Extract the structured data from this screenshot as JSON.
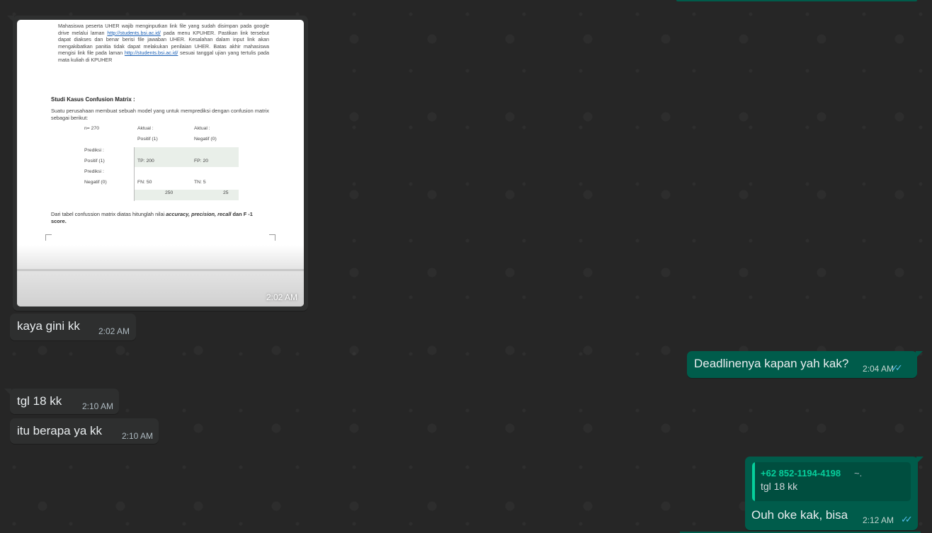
{
  "messages": {
    "image_msg": {
      "time": "2:02 AM",
      "doc": {
        "para_1": "Mahasiswa peserta UHER wajib menginputkan link file yang sudah disimpan pada google drive melalui laman",
        "link_1": "http://students.bsi.ac.id/",
        "para_2": " pada menu KPUHER. Pastikan link tersebut dapat diakses dan benar berisi file jawaban UHER. Kesalahan dalam input link akan mengakibatkan panitia tidak dapat melakukan penilaian UHER. Batas akhir mahasiswa mengisi link file pada laman ",
        "link_2": "http://students.bsi.ac.id/",
        "para_3": " sesuai tanggal ujian yang tertulis pada mata kuliah di KPUHER",
        "heading": "Studi Kasus Confusion Matrix :",
        "description": "Suatu perusahaan membuat sebuah model yang untuk memprediksi dengan confusion matrix sebagai berikut:",
        "matrix": {
          "n": "n= 270",
          "actual_1": "Aktual :",
          "actual_1_val": "Positif (1)",
          "actual_2": "Aktual :",
          "actual_2_val": "Negatif (0)",
          "pred_1": "Prediksi :",
          "pred_1_val": "Positif   (1)",
          "tp": "TP:  200",
          "fp": "FP:  20",
          "pred_2": "Prediksi :",
          "pred_2_val": "Negatif (0)",
          "fn": "FN:   50",
          "tn": "TN:   5",
          "sum_1": "250",
          "sum_2": "25"
        },
        "question_a": "Dari tabel confussion matrix diatas hitunglah nilai ",
        "question_b": "accuracy, precision, recall",
        "question_c": " dan F -1 score."
      }
    },
    "msg_1": {
      "text": "kaya gini kk",
      "time": "2:02 AM"
    },
    "msg_2": {
      "text": "Deadlinenya kapan yah kak?",
      "time": "2:04 AM",
      "status": "read-ticks-icon"
    },
    "msg_3": {
      "text": "tgl 18 kk",
      "time": "2:10 AM"
    },
    "msg_4": {
      "text": "itu berapa ya kk",
      "time": "2:10 AM"
    },
    "msg_5": {
      "quote_author": "+62 852-1194-4198",
      "quote_suffix": "~.",
      "quote_text": "tgl 18 kk",
      "text": "Ouh oke kak, bisa",
      "time": "2:12 AM",
      "status": "read-ticks-icon"
    }
  },
  "colors": {
    "background": "#262626",
    "incoming": "#2e2f2f",
    "outgoing": "#005c4b",
    "accent": "#06cf9c",
    "ticks": "#53bdeb"
  }
}
